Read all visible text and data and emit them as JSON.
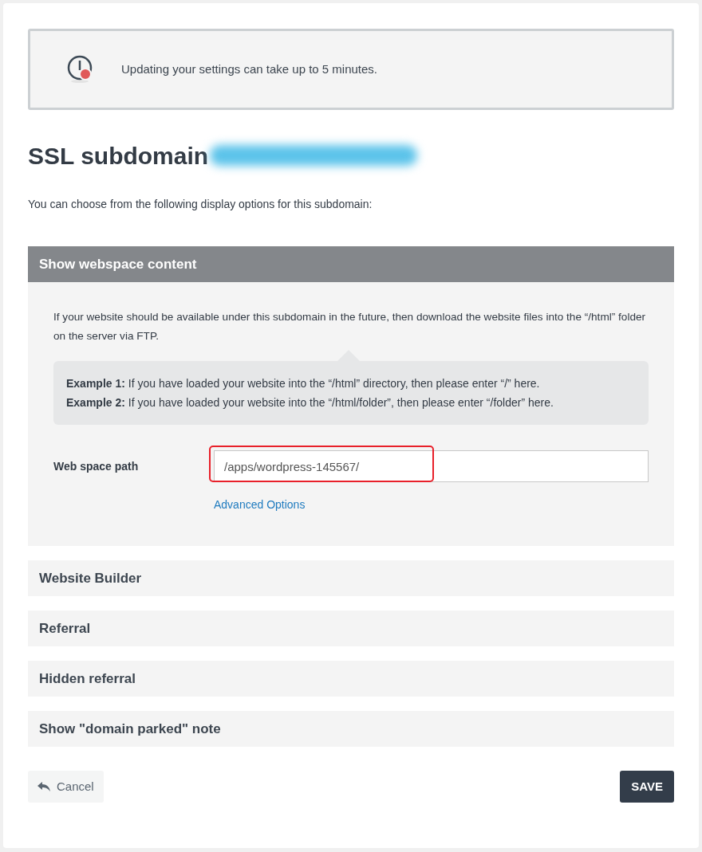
{
  "notice": {
    "text": "Updating your settings can take up to 5 minutes."
  },
  "heading": {
    "title": "SSL subdomain",
    "redacted": true
  },
  "intro": "You can choose from the following display options for this subdomain:",
  "sections": [
    {
      "title": "Show webspace content",
      "expanded": true,
      "description": "If your website should be available under this subdomain in the future, then download the website files into the “/html” folder on the server via FTP.",
      "examples": [
        "**Example 1:** If you have loaded your website into the “/html” directory, then please enter “/” here.",
        "**Example 2:** If you have loaded your website into the “/html/folder”, then please enter “/folder” here."
      ],
      "field": {
        "label": "Web space path",
        "value": "/apps/wordpress-145567/",
        "highlighted": true
      },
      "link": "Advanced Options"
    },
    {
      "title": "Website Builder",
      "expanded": false
    },
    {
      "title": "Referral",
      "expanded": false
    },
    {
      "title": "Hidden referral",
      "expanded": false
    },
    {
      "title": "Show \"domain parked\" note",
      "expanded": false
    }
  ],
  "buttons": {
    "cancel": "Cancel",
    "save": "SAVE"
  }
}
